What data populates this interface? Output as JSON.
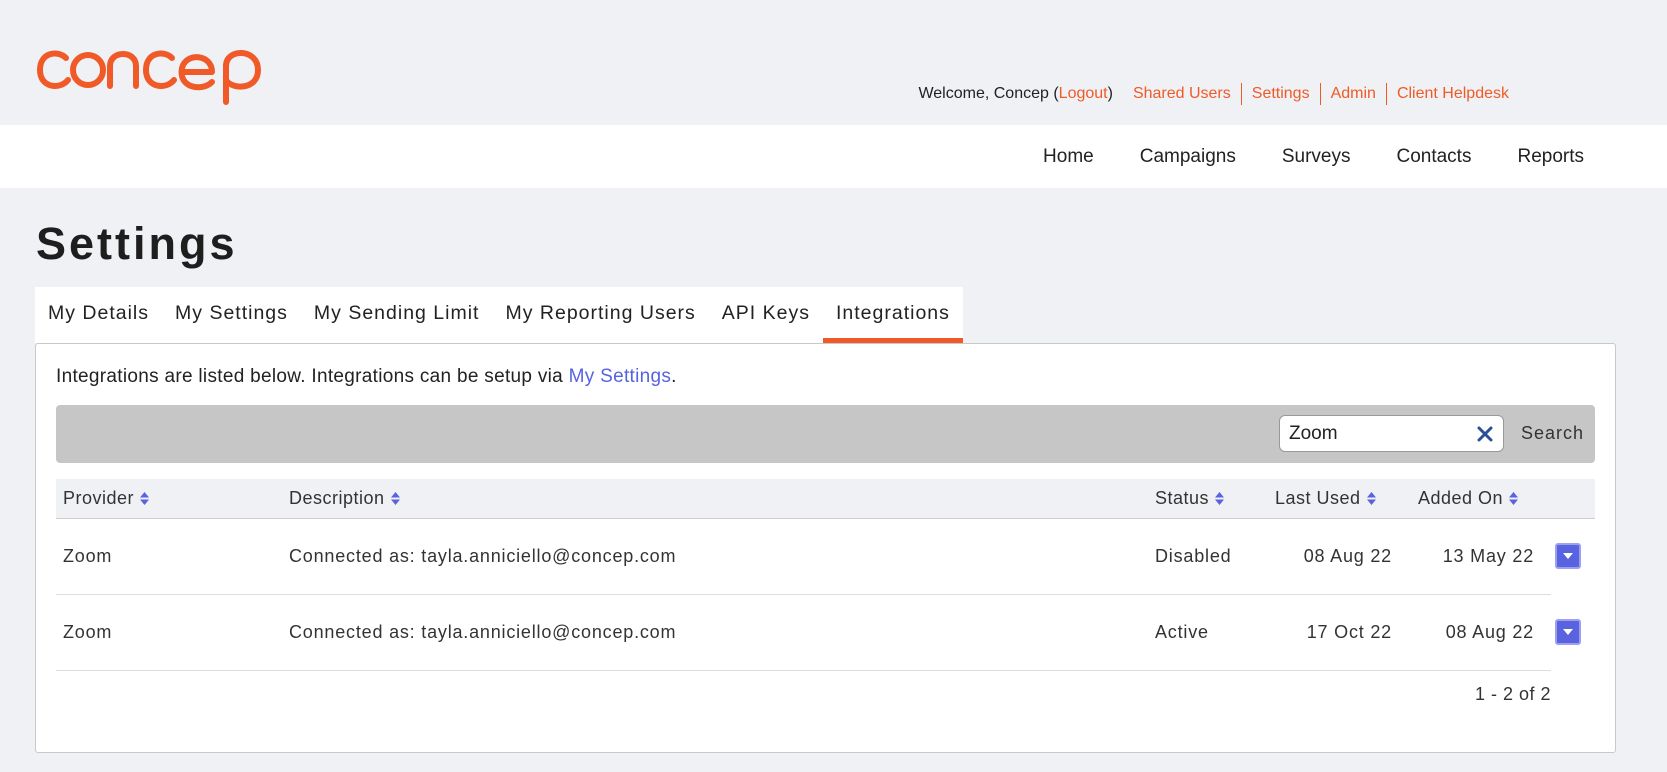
{
  "brand": {
    "logo_text": "concep",
    "accent": "#f05a28"
  },
  "userbar": {
    "welcome": "Welcome, Concep (",
    "logout": "Logout",
    "close_paren": ")",
    "links": [
      "Shared Users",
      "Settings",
      "Admin",
      "Client Helpdesk"
    ]
  },
  "nav": {
    "items": [
      "Home",
      "Campaigns",
      "Surveys",
      "Contacts",
      "Reports"
    ]
  },
  "page": {
    "title": "Settings"
  },
  "tabs": {
    "items": [
      "My Details",
      "My Settings",
      "My Sending Limit",
      "My Reporting Users",
      "API Keys",
      "Integrations"
    ],
    "active": "Integrations"
  },
  "intro": {
    "text": "Integrations are listed below. Integrations can be setup via ",
    "link": "My Settings",
    "suffix": "."
  },
  "search": {
    "value": "Zoom",
    "button": "Search",
    "clear_icon": "close-icon"
  },
  "table": {
    "columns": [
      "Provider",
      "Description",
      "Status",
      "Last Used",
      "Added On"
    ],
    "rows": [
      {
        "provider": "Zoom",
        "description": "Connected as: tayla.anniciello@concep.com",
        "status": "Disabled",
        "last_used": "08 Aug 22",
        "added_on": "13 May 22"
      },
      {
        "provider": "Zoom",
        "description": "Connected as: tayla.anniciello@concep.com",
        "status": "Active",
        "last_used": "17 Oct 22",
        "added_on": "08 Aug 22"
      }
    ],
    "pagination": "1 - 2 of 2"
  }
}
